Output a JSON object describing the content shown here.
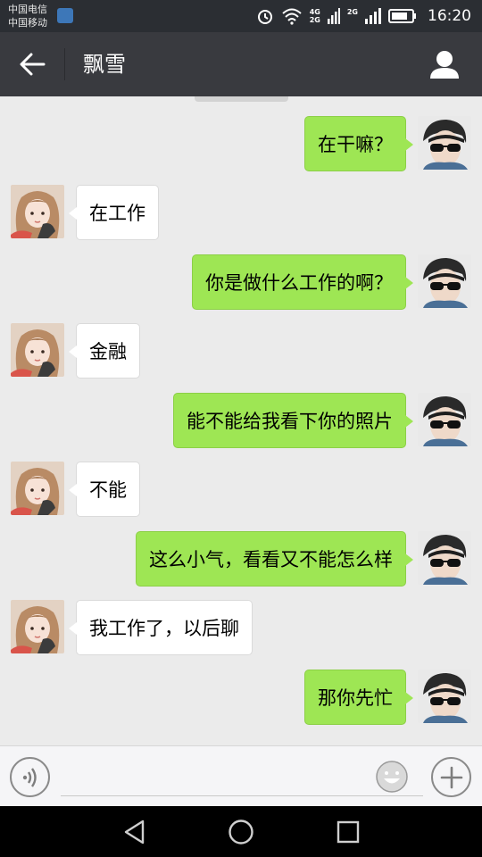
{
  "status_bar": {
    "carrier_1": "中国电信",
    "carrier_2": "中国移动",
    "net_1_top": "4G",
    "net_1_bottom": "2G",
    "net_2_top": "2G",
    "time": "16:20"
  },
  "header": {
    "title": "飘雪"
  },
  "messages": [
    {
      "side": "right",
      "text": "在干嘛？",
      "sender_avatar": "male-sunglasses-avatar"
    },
    {
      "side": "left",
      "text": "在工作",
      "sender_avatar": "female-avatar"
    },
    {
      "side": "right",
      "text": "你是做什么工作的啊？",
      "sender_avatar": "male-sunglasses-avatar"
    },
    {
      "side": "left",
      "text": "金融",
      "sender_avatar": "female-avatar"
    },
    {
      "side": "right",
      "text": "能不能给我看下你的照片",
      "sender_avatar": "male-sunglasses-avatar"
    },
    {
      "side": "left",
      "text": "不能",
      "sender_avatar": "female-avatar"
    },
    {
      "side": "right",
      "text": "这么小气，看看又不能怎么样",
      "sender_avatar": "male-sunglasses-avatar"
    },
    {
      "side": "left",
      "text": "我工作了，以后聊",
      "sender_avatar": "female-avatar"
    },
    {
      "side": "right",
      "text": "那你先忙",
      "sender_avatar": "male-sunglasses-avatar"
    }
  ],
  "input_bar": {
    "message_value": "",
    "icons": [
      "voice-icon",
      "emoji-icon",
      "plus-icon"
    ]
  },
  "nav_bar": {
    "icons": [
      "back-triangle-icon",
      "home-circle-icon",
      "recents-square-icon"
    ]
  },
  "colors": {
    "header_bg": "#393a3f",
    "outgoing_bubble": "#9ee654",
    "incoming_bubble": "#ffffff",
    "chat_bg": "#ebebeb"
  }
}
